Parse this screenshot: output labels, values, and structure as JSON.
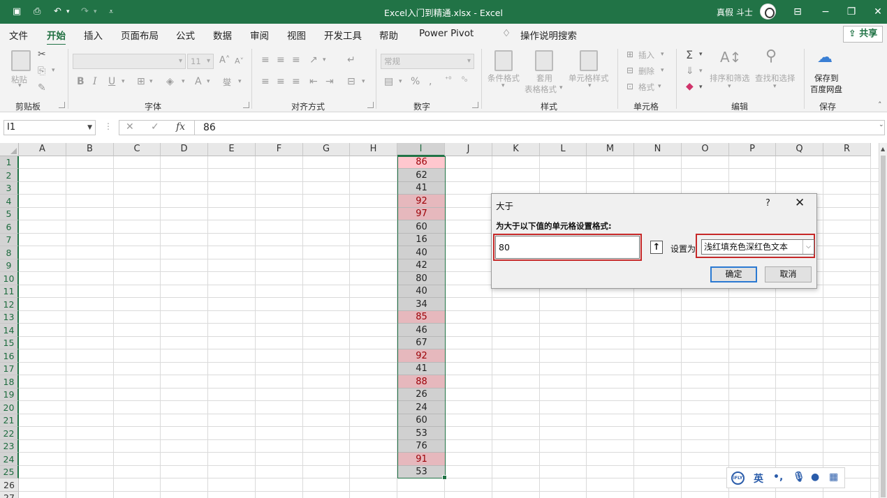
{
  "titlebar": {
    "title": "Excel入门到精通.xlsx  -  Excel",
    "user": "真假 斗士"
  },
  "menu": {
    "tabs": [
      "文件",
      "开始",
      "插入",
      "页面布局",
      "公式",
      "数据",
      "审阅",
      "视图",
      "开发工具",
      "帮助",
      "Power Pivot"
    ],
    "active_tab": "开始",
    "tell_me": "操作说明搜索",
    "share": "共享"
  },
  "ribbon": {
    "clipboard": {
      "label": "剪贴板",
      "paste": "粘贴"
    },
    "font": {
      "label": "字体",
      "font_size": "11",
      "bold": "B",
      "italic": "I",
      "underline": "U"
    },
    "alignment": {
      "label": "对齐方式"
    },
    "number": {
      "label": "数字",
      "format": "常规",
      "percent": "%"
    },
    "styles": {
      "label": "样式",
      "conditional": "条件格式",
      "table_format_1": "套用",
      "table_format_2": "表格格式",
      "cell_styles": "单元格样式"
    },
    "cells": {
      "label": "单元格",
      "insert": "插入",
      "delete": "删除",
      "format": "格式"
    },
    "editing": {
      "label": "编辑",
      "sort_filter": "排序和筛选",
      "find_select": "查找和选择"
    },
    "save": {
      "label": "保存",
      "save_to_1": "保存到",
      "save_to_2": "百度网盘"
    }
  },
  "formula_bar": {
    "name_box": "I1",
    "value": "86"
  },
  "grid": {
    "columns": [
      "A",
      "B",
      "C",
      "D",
      "E",
      "F",
      "G",
      "H",
      "I",
      "J",
      "K",
      "L",
      "M",
      "N",
      "O",
      "P",
      "Q",
      "R"
    ],
    "selected_column": "I",
    "rows": [
      "1",
      "2",
      "3",
      "4",
      "5",
      "6",
      "7",
      "8",
      "9",
      "10",
      "11",
      "12",
      "13",
      "14",
      "15",
      "16",
      "17",
      "18",
      "19",
      "20",
      "21",
      "22",
      "23",
      "24",
      "25",
      "26",
      "27"
    ],
    "column_i_values": [
      "86",
      "62",
      "41",
      "92",
      "97",
      "60",
      "16",
      "40",
      "42",
      "80",
      "40",
      "34",
      "85",
      "46",
      "67",
      "92",
      "41",
      "88",
      "26",
      "24",
      "60",
      "53",
      "76",
      "91",
      "53"
    ]
  },
  "dialog": {
    "title": "大于",
    "help": "?",
    "prompt": "为大于以下值的单元格设置格式:",
    "threshold": "80",
    "set_as_label": "设置为",
    "format_option": "浅红填充色深红色文本",
    "ok": "确定",
    "cancel": "取消"
  },
  "ime": {
    "lang": "英",
    "logo": "iFLY"
  },
  "colors": {
    "excel_green": "#217346",
    "highlight_fill": "#ffc7ce",
    "highlight_text": "#9c0006",
    "annotation_red": "#c62828"
  }
}
